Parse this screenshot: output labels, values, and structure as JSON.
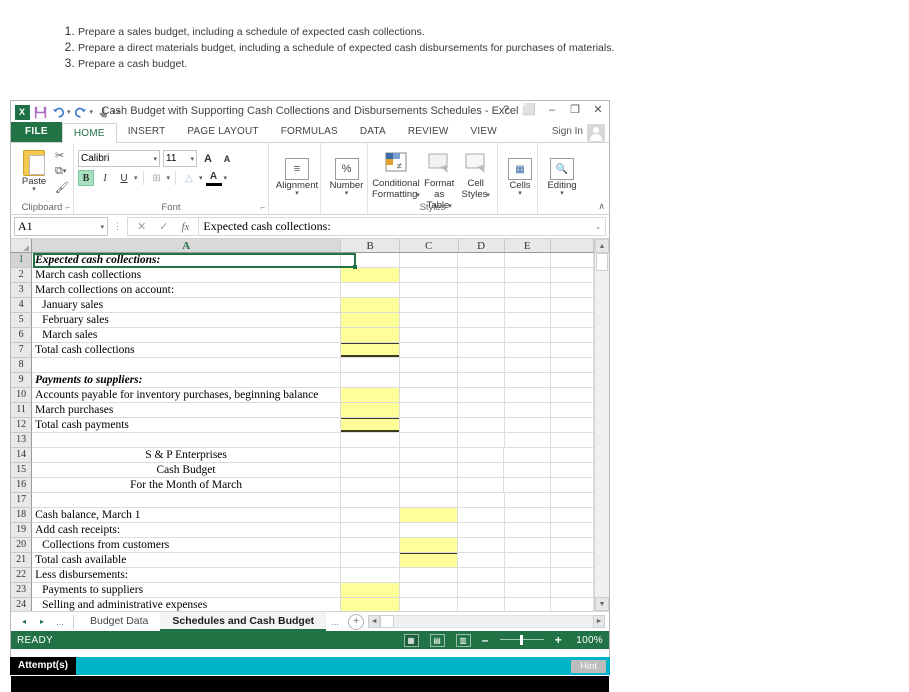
{
  "instructions": [
    "Prepare a sales budget, including a schedule of expected cash collections.",
    "Prepare a direct materials budget, including a schedule of expected cash disbursements for purchases of materials.",
    "Prepare a cash budget."
  ],
  "window": {
    "title": "Cash Budget with Supporting Cash Collections and Disbursements Schedules - Excel",
    "help": "?",
    "ribbon_display": "⬜",
    "minimize": "–",
    "restore": "❐",
    "close": "✕",
    "quick_access": [
      "excel-logo",
      "save-icon",
      "undo-icon",
      "redo-icon",
      "touch-mode-icon",
      "customize-qat-icon"
    ],
    "excel_logo_text": "X"
  },
  "ribbon": {
    "file_tab": "FILE",
    "tabs": [
      "HOME",
      "INSERT",
      "PAGE LAYOUT",
      "FORMULAS",
      "DATA",
      "REVIEW",
      "VIEW"
    ],
    "active_tab": "HOME",
    "sign_in": "Sign In",
    "groups": {
      "clipboard": {
        "label": "Clipboard",
        "paste": "Paste",
        "cut": "Cut",
        "copy": "Copy",
        "format_painter": "Format Painter"
      },
      "font": {
        "label": "Font",
        "font_name": "Calibri",
        "font_size": "11",
        "grow_font": "A",
        "shrink_font": "A",
        "bold": "B",
        "italic": "I",
        "underline": "U",
        "borders": "⊞",
        "fill_color": "△",
        "font_color": "A"
      },
      "alignment": {
        "label": "Alignment"
      },
      "number": {
        "label": "Number",
        "symbol": "%"
      },
      "styles": {
        "label": "Styles",
        "conditional_formatting": "Conditional Formatting",
        "format_as_table": "Format as Table",
        "cell_styles": "Cell Styles"
      },
      "cells": {
        "label": "Cells"
      },
      "editing": {
        "label": "Editing"
      }
    },
    "collapse": "∧"
  },
  "formula_bar": {
    "name_box": "A1",
    "cancel": "✕",
    "enter": "✓",
    "insert_function": "fx",
    "value": "Expected cash collections:",
    "expand": "⌄"
  },
  "grid": {
    "columns": [
      "A",
      "B",
      "C",
      "D",
      "E"
    ],
    "selected_column": "A",
    "selected_cell": "A1",
    "rows": [
      {
        "n": "1",
        "a": "Expected cash collections:",
        "style": "bi"
      },
      {
        "n": "2",
        "a": "March cash collections",
        "b_fill": "yellow"
      },
      {
        "n": "3",
        "a": "March collections on account:"
      },
      {
        "n": "4",
        "a": "January sales",
        "indent": true,
        "b_fill": "yellow"
      },
      {
        "n": "5",
        "a": "February sales",
        "indent": true,
        "b_fill": "yellow"
      },
      {
        "n": "6",
        "a": "March sales",
        "indent": true,
        "b_fill": "yellow"
      },
      {
        "n": "7",
        "a": "Total cash collections",
        "b_fill": "yellow",
        "b_border": "total"
      },
      {
        "n": "8",
        "a": ""
      },
      {
        "n": "9",
        "a": "Payments to suppliers:",
        "style": "bi"
      },
      {
        "n": "10",
        "a": "Accounts payable for inventory purchases, beginning balance",
        "b_fill": "yellow"
      },
      {
        "n": "11",
        "a": "March purchases",
        "b_fill": "yellow"
      },
      {
        "n": "12",
        "a": "Total cash payments",
        "b_fill": "yellow",
        "b_border": "total"
      },
      {
        "n": "13",
        "a": ""
      },
      {
        "n": "14",
        "a": "S & P Enterprises",
        "center": true
      },
      {
        "n": "15",
        "a": "Cash Budget",
        "center": true
      },
      {
        "n": "16",
        "a": "For the Month of March",
        "center": true
      },
      {
        "n": "17",
        "a": ""
      },
      {
        "n": "18",
        "a": "Cash balance, March 1",
        "c_fill": "yellow"
      },
      {
        "n": "19",
        "a": "Add cash receipts:"
      },
      {
        "n": "20",
        "a": "Collections from customers",
        "indent": true,
        "c_fill": "yellow"
      },
      {
        "n": "21",
        "a": "Total cash available",
        "c_fill": "yellow",
        "c_border": "top"
      },
      {
        "n": "22",
        "a": "Less disbursements:"
      },
      {
        "n": "23",
        "a": "Payments to suppliers",
        "indent": true,
        "b_fill": "yellow"
      },
      {
        "n": "24",
        "a": "Selling and administrative expenses",
        "indent": true,
        "b_fill": "yellow"
      }
    ]
  },
  "sheet_tabs": {
    "first": "◂",
    "prev": "▸",
    "dots_left": "...",
    "tabs": [
      "Budget Data",
      "Schedules and Cash Budget"
    ],
    "active": "Schedules and Cash Budget",
    "dots_right": "...",
    "new_sheet": "+"
  },
  "status_bar": {
    "state": "READY",
    "views": [
      "normal-view",
      "page-layout-view",
      "page-break-view"
    ],
    "zoom_out": "–",
    "zoom_in": "+",
    "zoom_level": "100%"
  },
  "attempt_bar": {
    "label": "Attempt(s)",
    "hint": "Hint"
  }
}
